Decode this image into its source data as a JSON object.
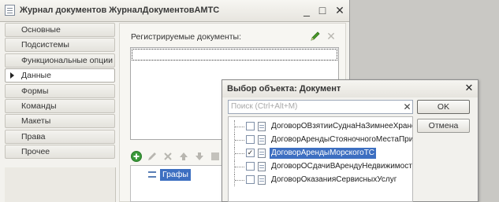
{
  "window": {
    "title": "Журнал документов ЖурналДокументовАМТС",
    "min_glyph": "_",
    "max_glyph": "□",
    "close_glyph": "✕"
  },
  "nav": {
    "items": [
      {
        "label": "Основные"
      },
      {
        "label": "Подсистемы"
      },
      {
        "label": "Функциональные опции"
      },
      {
        "label": "Данные",
        "active": true
      },
      {
        "label": "Формы"
      },
      {
        "label": "Команды"
      },
      {
        "label": "Макеты"
      },
      {
        "label": "Права"
      },
      {
        "label": "Прочее"
      }
    ]
  },
  "main": {
    "registered_label": "Регистрируемые документы:",
    "graph_items": [
      {
        "label": "Графы"
      }
    ]
  },
  "dialog": {
    "title": "Выбор объекта: Документ",
    "close_glyph": "✕",
    "search_placeholder": "Поиск (Ctrl+Alt+M)",
    "search_clear_glyph": "✕",
    "ok_label": "OK",
    "cancel_label": "Отмена",
    "items": [
      {
        "label": "ДоговорОВзятииСуднаНаЗимнееХранен",
        "checked": false
      },
      {
        "label": "ДоговорАрендыСтояночногоМестаПрича",
        "checked": false
      },
      {
        "label": "ДоговорАрендыМорскогоТС",
        "checked": true,
        "selected": true
      },
      {
        "label": "ДоговорОСдачиВАрендуНедвижимости",
        "checked": false
      },
      {
        "label": "ДоговорОказанияСервисныхУслуг",
        "checked": false
      }
    ]
  },
  "colors": {
    "selection": "#3d6fc1",
    "add_green": "#3a9a3a",
    "pencil_green": "#4a9a2a"
  }
}
